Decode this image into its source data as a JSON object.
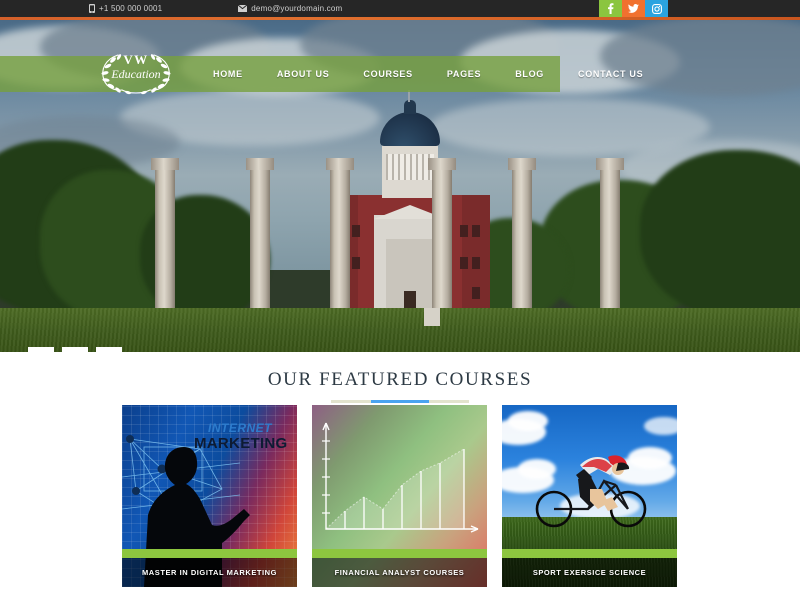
{
  "topbar": {
    "phone": "+1 500 000 0001",
    "email": "demo@yourdomain.com",
    "phone_icon": "phone-icon",
    "email_icon": "envelope-icon",
    "social": [
      {
        "name": "facebook",
        "glyph": "f",
        "color": "#8bc53f"
      },
      {
        "name": "twitter",
        "glyph": "t",
        "color": "#f1712f"
      },
      {
        "name": "instagram",
        "glyph": "i",
        "color": "#2aa3e0"
      }
    ]
  },
  "brand": {
    "line1": "VW",
    "line2": "Education",
    "emblem": "laurel-wreath-icon"
  },
  "nav": {
    "items": [
      {
        "label": "HOME"
      },
      {
        "label": "ABOUT US"
      },
      {
        "label": "COURSES"
      },
      {
        "label": "PAGES"
      },
      {
        "label": "BLOG"
      },
      {
        "label": "CONTACT US"
      }
    ],
    "bar_color": "#77a03e"
  },
  "hero": {
    "slides": [
      {
        "index": 1
      },
      {
        "index": 2
      },
      {
        "index": 3
      }
    ],
    "active_slide": 1
  },
  "featured": {
    "heading": "OUR FEATURED COURSES",
    "divider_color": "#4aa3f0",
    "accent_color": "#8dc63f",
    "cards": [
      {
        "title": "MASTER IN DIGITAL MARKETING",
        "art_word_top": "INTERNET",
        "art_word_main": "MARKETING"
      },
      {
        "title": "FINANCIAL ANALYST COURSES"
      },
      {
        "title": "SPORT EXERSICE SCIENCE"
      }
    ]
  }
}
